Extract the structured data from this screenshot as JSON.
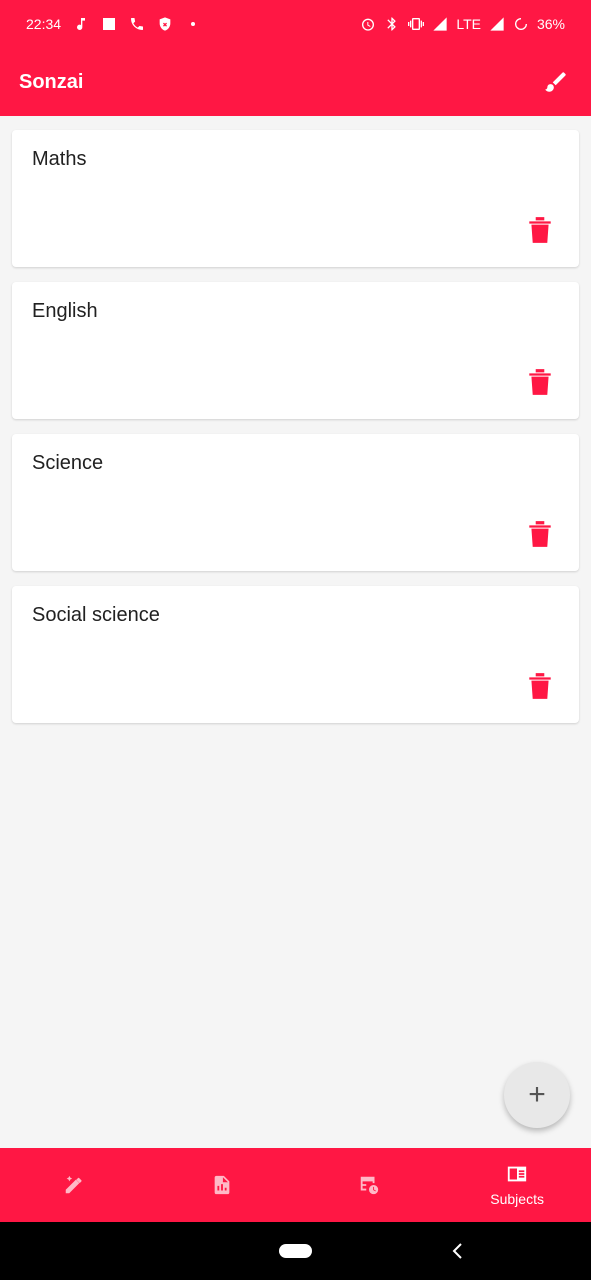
{
  "status_bar": {
    "time": "22:34",
    "battery": "36%",
    "network": "LTE"
  },
  "app_bar": {
    "title": "Sonzai",
    "action_icon": "brush-icon"
  },
  "subjects": [
    {
      "name": "Maths"
    },
    {
      "name": "English"
    },
    {
      "name": "Science"
    },
    {
      "name": "Social science"
    }
  ],
  "fab": {
    "icon": "plus-icon",
    "label": "+"
  },
  "bottom_nav": {
    "items": [
      {
        "icon": "edit-sparkle-icon",
        "label": ""
      },
      {
        "icon": "report-chart-icon",
        "label": ""
      },
      {
        "icon": "schedule-table-icon",
        "label": ""
      },
      {
        "icon": "subjects-book-icon",
        "label": "Subjects"
      }
    ],
    "active": 3
  },
  "colors": {
    "accent": "#ff1744",
    "background": "#f5f5f5",
    "card": "#ffffff"
  }
}
